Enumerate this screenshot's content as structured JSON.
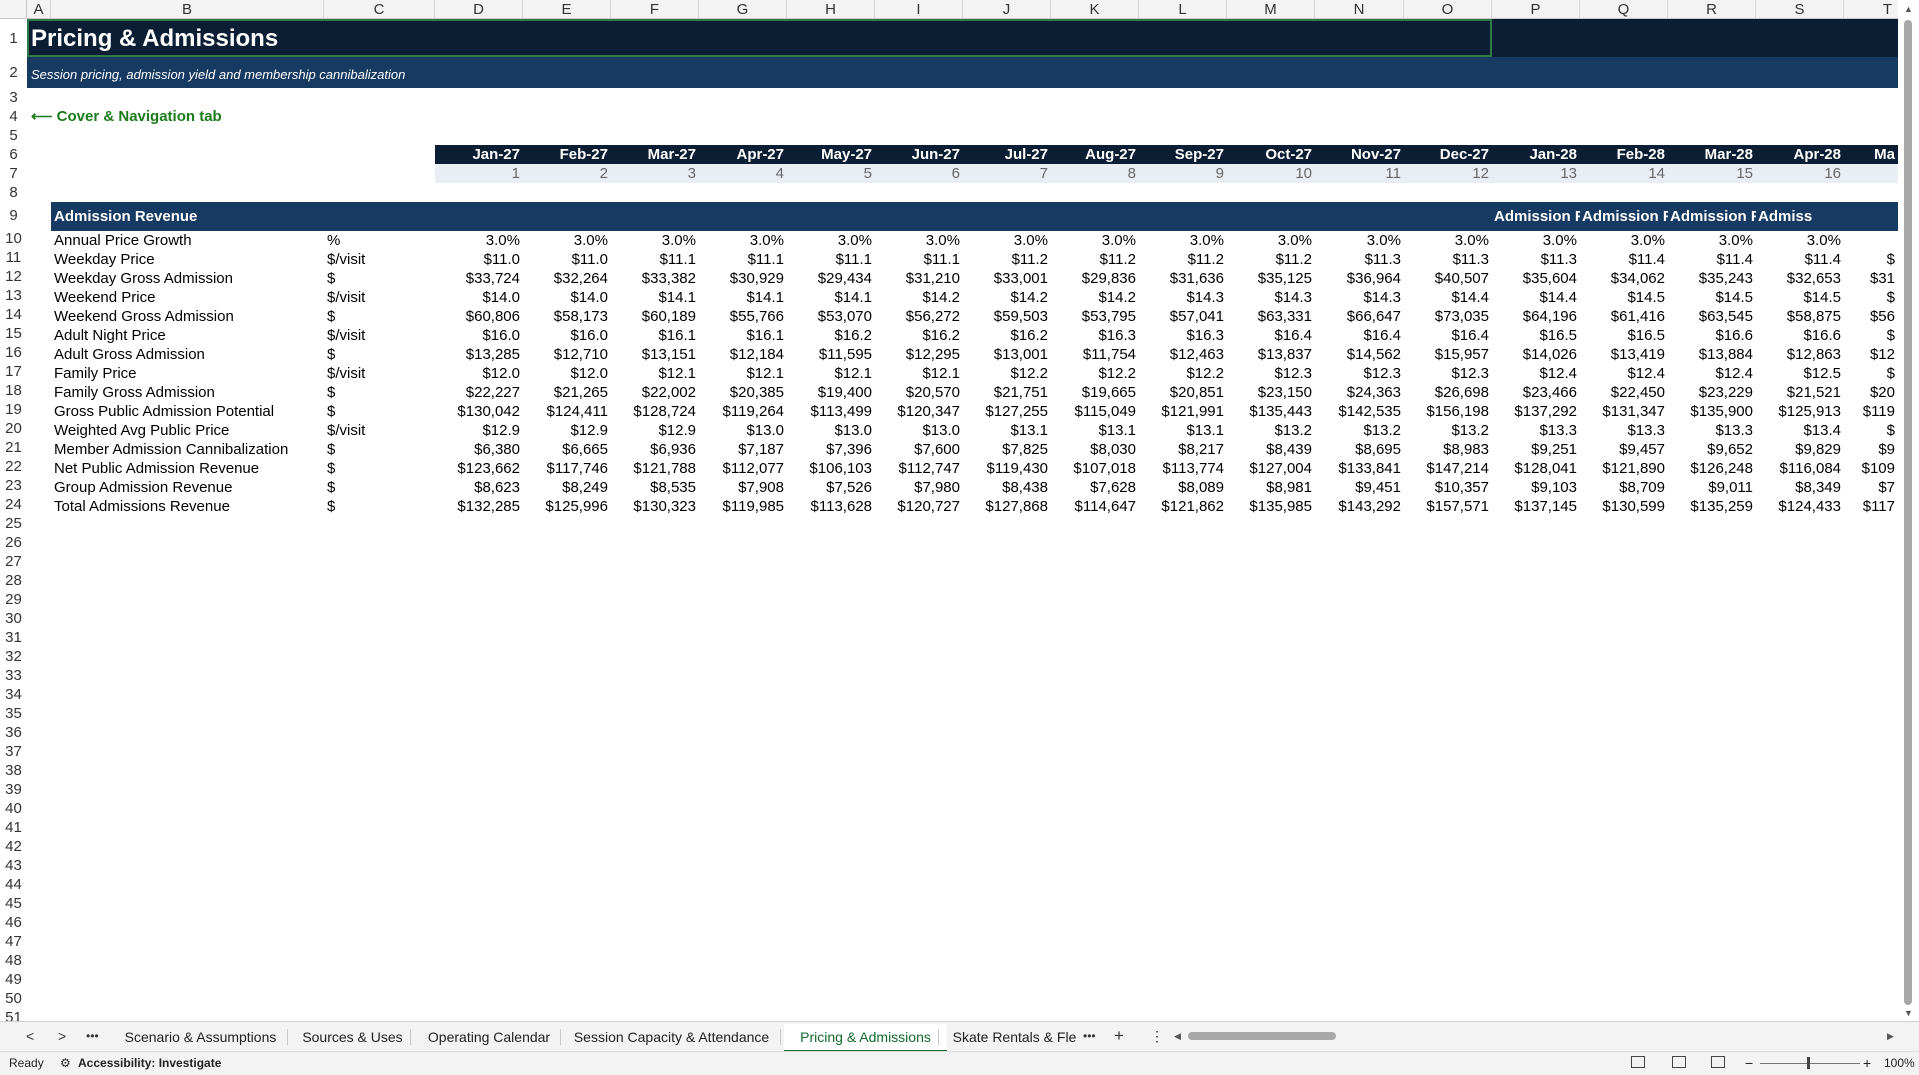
{
  "columns": [
    "A",
    "B",
    "C",
    "D",
    "E",
    "F",
    "G",
    "H",
    "I",
    "J",
    "K",
    "L",
    "M",
    "N",
    "O",
    "P",
    "Q",
    "R",
    "S",
    "T"
  ],
  "rows": [
    "1",
    "2",
    "3",
    "4",
    "5",
    "6",
    "7",
    "8",
    "9",
    "10",
    "11",
    "12",
    "13",
    "14",
    "15",
    "16",
    "17",
    "18",
    "19",
    "20",
    "21",
    "22",
    "23",
    "24",
    "25",
    "26",
    "27",
    "28",
    "29",
    "30",
    "31",
    "32",
    "33",
    "34",
    "35",
    "36",
    "37",
    "38",
    "39",
    "40",
    "41",
    "42",
    "43",
    "44",
    "45",
    "46",
    "47",
    "48",
    "49",
    "50",
    "51"
  ],
  "sheet": {
    "title": "Pricing & Admissions",
    "subtitle": "Session pricing, admission yield and membership cannibalization",
    "nav_link": "⟵ Cover & Navigation tab",
    "months": [
      "Jan-27",
      "Feb-27",
      "Mar-27",
      "Apr-27",
      "May-27",
      "Jun-27",
      "Jul-27",
      "Aug-27",
      "Sep-27",
      "Oct-27",
      "Nov-27",
      "Dec-27",
      "Jan-28",
      "Feb-28",
      "Mar-28",
      "Apr-28",
      "Ma"
    ],
    "month_index": [
      "1",
      "2",
      "3",
      "4",
      "5",
      "6",
      "7",
      "8",
      "9",
      "10",
      "11",
      "12",
      "13",
      "14",
      "15",
      "16",
      ""
    ],
    "section_title": "Admission Revenue",
    "section_repeats": [
      "Admission R",
      "Admission R",
      "Admission R",
      "Admiss"
    ],
    "lines": [
      {
        "label": "Annual Price Growth",
        "unit": "%",
        "values": [
          "3.0%",
          "3.0%",
          "3.0%",
          "3.0%",
          "3.0%",
          "3.0%",
          "3.0%",
          "3.0%",
          "3.0%",
          "3.0%",
          "3.0%",
          "3.0%",
          "3.0%",
          "3.0%",
          "3.0%",
          "3.0%",
          ""
        ]
      },
      {
        "label": "Weekday Price",
        "unit": "$/visit",
        "values": [
          "$11.0",
          "$11.0",
          "$11.1",
          "$11.1",
          "$11.1",
          "$11.1",
          "$11.2",
          "$11.2",
          "$11.2",
          "$11.2",
          "$11.3",
          "$11.3",
          "$11.3",
          "$11.4",
          "$11.4",
          "$11.4",
          "$"
        ]
      },
      {
        "label": "Weekday Gross Admission",
        "unit": "$",
        "values": [
          "$33,724",
          "$32,264",
          "$33,382",
          "$30,929",
          "$29,434",
          "$31,210",
          "$33,001",
          "$29,836",
          "$31,636",
          "$35,125",
          "$36,964",
          "$40,507",
          "$35,604",
          "$34,062",
          "$35,243",
          "$32,653",
          "$31"
        ]
      },
      {
        "label": "Weekend Price",
        "unit": "$/visit",
        "values": [
          "$14.0",
          "$14.0",
          "$14.1",
          "$14.1",
          "$14.1",
          "$14.2",
          "$14.2",
          "$14.2",
          "$14.3",
          "$14.3",
          "$14.3",
          "$14.4",
          "$14.4",
          "$14.5",
          "$14.5",
          "$14.5",
          "$"
        ]
      },
      {
        "label": "Weekend Gross Admission",
        "unit": "$",
        "values": [
          "$60,806",
          "$58,173",
          "$60,189",
          "$55,766",
          "$53,070",
          "$56,272",
          "$59,503",
          "$53,795",
          "$57,041",
          "$63,331",
          "$66,647",
          "$73,035",
          "$64,196",
          "$61,416",
          "$63,545",
          "$58,875",
          "$56"
        ]
      },
      {
        "label": "Adult Night Price",
        "unit": "$/visit",
        "values": [
          "$16.0",
          "$16.0",
          "$16.1",
          "$16.1",
          "$16.2",
          "$16.2",
          "$16.2",
          "$16.3",
          "$16.3",
          "$16.4",
          "$16.4",
          "$16.4",
          "$16.5",
          "$16.5",
          "$16.6",
          "$16.6",
          "$"
        ]
      },
      {
        "label": "Adult Gross Admission",
        "unit": "$",
        "values": [
          "$13,285",
          "$12,710",
          "$13,151",
          "$12,184",
          "$11,595",
          "$12,295",
          "$13,001",
          "$11,754",
          "$12,463",
          "$13,837",
          "$14,562",
          "$15,957",
          "$14,026",
          "$13,419",
          "$13,884",
          "$12,863",
          "$12"
        ]
      },
      {
        "label": "Family Price",
        "unit": "$/visit",
        "values": [
          "$12.0",
          "$12.0",
          "$12.1",
          "$12.1",
          "$12.1",
          "$12.1",
          "$12.2",
          "$12.2",
          "$12.2",
          "$12.3",
          "$12.3",
          "$12.3",
          "$12.4",
          "$12.4",
          "$12.4",
          "$12.5",
          "$"
        ]
      },
      {
        "label": "Family Gross Admission",
        "unit": "$",
        "values": [
          "$22,227",
          "$21,265",
          "$22,002",
          "$20,385",
          "$19,400",
          "$20,570",
          "$21,751",
          "$19,665",
          "$20,851",
          "$23,150",
          "$24,363",
          "$26,698",
          "$23,466",
          "$22,450",
          "$23,229",
          "$21,521",
          "$20"
        ]
      },
      {
        "label": "Gross Public Admission Potential",
        "unit": "$",
        "values": [
          "$130,042",
          "$124,411",
          "$128,724",
          "$119,264",
          "$113,499",
          "$120,347",
          "$127,255",
          "$115,049",
          "$121,991",
          "$135,443",
          "$142,535",
          "$156,198",
          "$137,292",
          "$131,347",
          "$135,900",
          "$125,913",
          "$119"
        ]
      },
      {
        "label": "Weighted Avg Public Price",
        "unit": "$/visit",
        "values": [
          "$12.9",
          "$12.9",
          "$12.9",
          "$13.0",
          "$13.0",
          "$13.0",
          "$13.1",
          "$13.1",
          "$13.1",
          "$13.2",
          "$13.2",
          "$13.2",
          "$13.3",
          "$13.3",
          "$13.3",
          "$13.4",
          "$"
        ]
      },
      {
        "label": "Member Admission Cannibalization",
        "unit": "$",
        "values": [
          "$6,380",
          "$6,665",
          "$6,936",
          "$7,187",
          "$7,396",
          "$7,600",
          "$7,825",
          "$8,030",
          "$8,217",
          "$8,439",
          "$8,695",
          "$8,983",
          "$9,251",
          "$9,457",
          "$9,652",
          "$9,829",
          "$9"
        ]
      },
      {
        "label": "Net Public Admission Revenue",
        "unit": "$",
        "values": [
          "$123,662",
          "$117,746",
          "$121,788",
          "$112,077",
          "$106,103",
          "$112,747",
          "$119,430",
          "$107,018",
          "$113,774",
          "$127,004",
          "$133,841",
          "$147,214",
          "$128,041",
          "$121,890",
          "$126,248",
          "$116,084",
          "$109"
        ]
      },
      {
        "label": "Group Admission Revenue",
        "unit": "$",
        "values": [
          "$8,623",
          "$8,249",
          "$8,535",
          "$7,908",
          "$7,526",
          "$7,980",
          "$8,438",
          "$7,628",
          "$8,089",
          "$8,981",
          "$9,451",
          "$10,357",
          "$9,103",
          "$8,709",
          "$9,011",
          "$8,349",
          "$7"
        ]
      },
      {
        "label": "Total Admissions Revenue",
        "unit": "$",
        "values": [
          "$132,285",
          "$125,996",
          "$130,323",
          "$119,985",
          "$113,628",
          "$120,727",
          "$127,868",
          "$114,647",
          "$121,862",
          "$135,985",
          "$143,292",
          "$157,571",
          "$137,145",
          "$130,599",
          "$135,259",
          "$124,433",
          "$117"
        ]
      }
    ]
  },
  "tabs": {
    "items": [
      "Scenario & Assumptions",
      "Sources & Uses",
      "Operating Calendar",
      "Session Capacity & Attendance",
      "Pricing & Admissions",
      "Skate Rentals & Fle"
    ],
    "active_index": 4,
    "more": "•••",
    "add": "+",
    "options": "⋮"
  },
  "status": {
    "ready": "Ready",
    "accessibility": "Accessibility: Investigate",
    "zoom": "100%"
  }
}
